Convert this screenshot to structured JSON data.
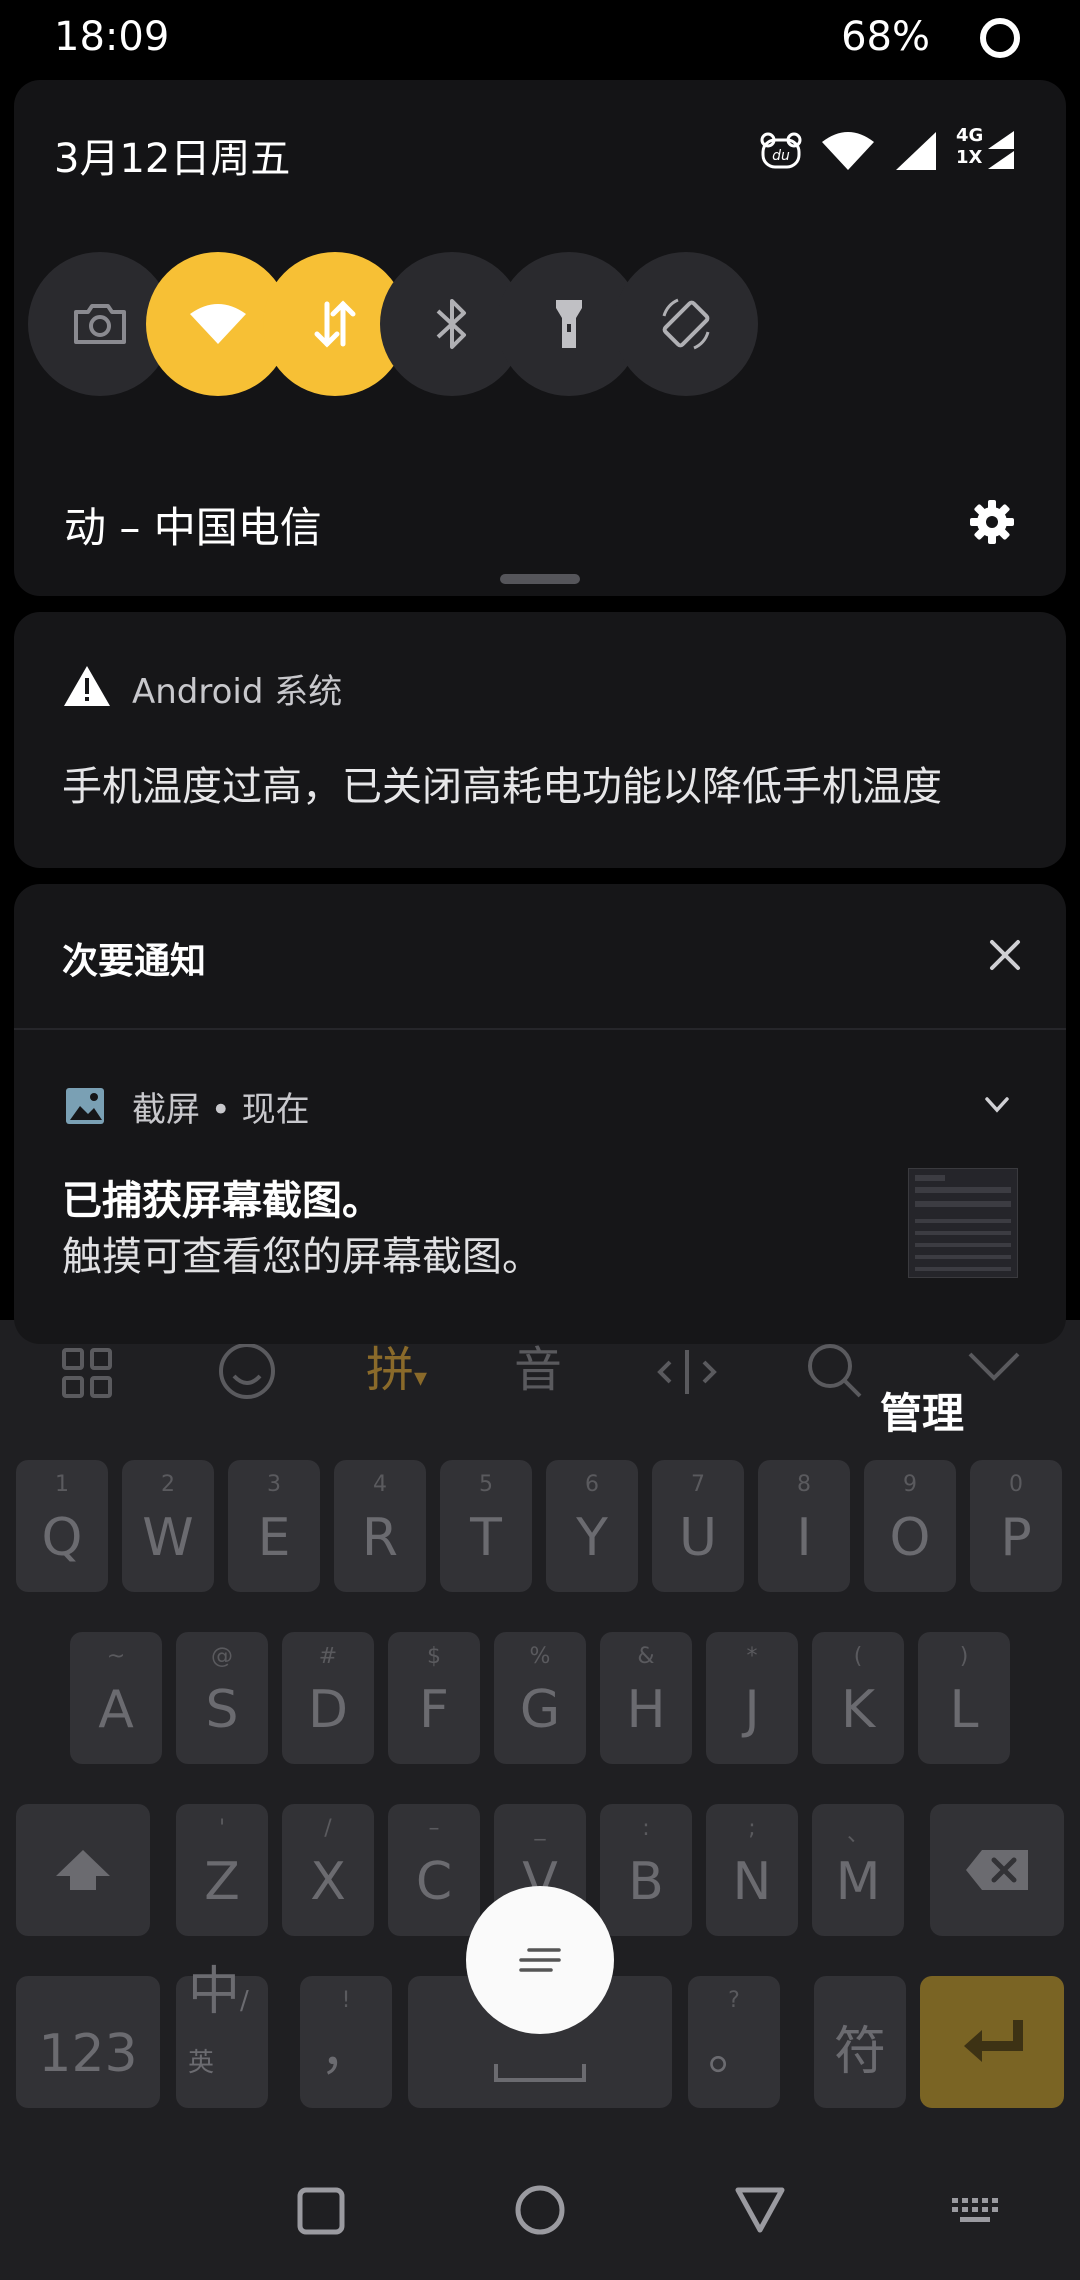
{
  "status_bar": {
    "time": "18:09",
    "battery": "68%"
  },
  "quick_settings": {
    "date": "3月12日周五",
    "network_label_top": "4G",
    "network_label_bottom": "1X",
    "carrier_line": "动 – 中国电信",
    "tiles": [
      {
        "name": "camera-icon",
        "on": false
      },
      {
        "name": "wifi-icon",
        "on": true
      },
      {
        "name": "mobile-data-icon",
        "on": true
      },
      {
        "name": "bluetooth-icon",
        "on": false
      },
      {
        "name": "flashlight-icon",
        "on": false
      },
      {
        "name": "auto-rotate-icon",
        "on": false
      }
    ],
    "accent_color": "#f7c035"
  },
  "notification_system": {
    "app": "Android 系统",
    "body": "手机温度过高，已关闭高耗电功能以降低手机温度"
  },
  "secondary_notifications": {
    "title": "次要通知",
    "screenshot": {
      "app_line": "截屏 • 现在",
      "title": "已捕获屏幕截图。",
      "text": "触摸可查看您的屏幕截图。"
    }
  },
  "keyboard": {
    "manage_label": "管理",
    "toolbar": {
      "pinyin": "拼",
      "voice": "音"
    },
    "row1": [
      {
        "sub": "1",
        "key": "Q"
      },
      {
        "sub": "2",
        "key": "W"
      },
      {
        "sub": "3",
        "key": "E"
      },
      {
        "sub": "4",
        "key": "R"
      },
      {
        "sub": "5",
        "key": "T"
      },
      {
        "sub": "6",
        "key": "Y"
      },
      {
        "sub": "7",
        "key": "U"
      },
      {
        "sub": "8",
        "key": "I"
      },
      {
        "sub": "9",
        "key": "O"
      },
      {
        "sub": "0",
        "key": "P"
      }
    ],
    "row2": [
      {
        "sub": "~",
        "key": "A"
      },
      {
        "sub": "@",
        "key": "S"
      },
      {
        "sub": "#",
        "key": "D"
      },
      {
        "sub": "$",
        "key": "F"
      },
      {
        "sub": "%",
        "key": "G"
      },
      {
        "sub": "&",
        "key": "H"
      },
      {
        "sub": "*",
        "key": "J"
      },
      {
        "sub": "(",
        "key": "K"
      },
      {
        "sub": ")",
        "key": "L"
      }
    ],
    "row3": [
      {
        "sub": "'",
        "key": "Z"
      },
      {
        "sub": "/",
        "key": "X"
      },
      {
        "sub": "–",
        "key": "C"
      },
      {
        "sub": "_",
        "key": "V"
      },
      {
        "sub": ":",
        "key": "B"
      },
      {
        "sub": ";",
        "key": "N"
      },
      {
        "sub": "、",
        "key": "M"
      }
    ],
    "row4": {
      "num": "123",
      "lang_main": "中",
      "lang_sub": "/英",
      "comma_sub": "!",
      "comma": "，",
      "period_sub": "?",
      "period": "。",
      "symbols": "符"
    }
  }
}
